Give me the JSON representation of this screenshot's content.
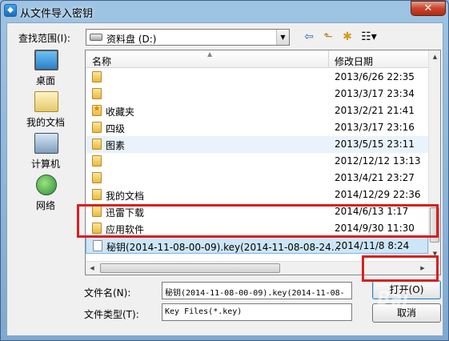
{
  "window": {
    "title": "从文件导入密钥",
    "close_glyph": "✕"
  },
  "lookin": {
    "label": "查找范围(I):",
    "value": "资料盘 (D:)",
    "arrow": "▼"
  },
  "toolbar": {
    "back_glyph": "⇦",
    "up_glyph": "⬑",
    "newfolder_glyph": "✱",
    "view_glyph": "☷▾"
  },
  "places": [
    {
      "label": "桌面",
      "icon": "desktop-icon"
    },
    {
      "label": "我的文档",
      "icon": "documents-icon"
    },
    {
      "label": "计算机",
      "icon": "computer-icon"
    },
    {
      "label": "网络",
      "icon": "network-icon"
    }
  ],
  "columns": {
    "name": "名称",
    "date": "修改日期",
    "sort_glyph": "▲"
  },
  "rows": [
    {
      "name": "",
      "date": "2013/6/26 22:35",
      "icon": "folder"
    },
    {
      "name": "",
      "date": "2013/3/17 23:34",
      "icon": "folder"
    },
    {
      "name": "收藏夹",
      "date": "2013/2/21 21:41",
      "icon": "favorites"
    },
    {
      "name": "四级",
      "date": "2013/3/17 23:16",
      "icon": "folder"
    },
    {
      "name": "图素",
      "date": "2013/5/15 23:11",
      "icon": "folder"
    },
    {
      "name": "",
      "date": "2012/12/12 13:13",
      "icon": "folder"
    },
    {
      "name": "",
      "date": "2013/4/21 23:27",
      "icon": "folder"
    },
    {
      "name": "我的文档",
      "date": "2014/12/29 22:36",
      "icon": "folder"
    },
    {
      "name": "迅雷下载",
      "date": "2014/6/13 1:17",
      "icon": "folder"
    },
    {
      "name": "应用软件",
      "date": "2014/9/30 11:30",
      "icon": "folder"
    },
    {
      "name": "秘钥(2014-11-08-00-09).key(2014-11-08-08-24...",
      "date": "2014/11/8 8:24",
      "icon": "file"
    }
  ],
  "scroll": {
    "up": "▲",
    "down": "▼",
    "left": "◀",
    "right": "▶"
  },
  "filename": {
    "label": "文件名(N):",
    "value": "秘钥(2014-11-08-00-09).key(2014-11-08-"
  },
  "filetype": {
    "label": "文件类型(T):",
    "value": "Key Files(*.key)"
  },
  "buttons": {
    "open": "打开(O)",
    "cancel": "取消"
  },
  "watermark": "Bai"
}
